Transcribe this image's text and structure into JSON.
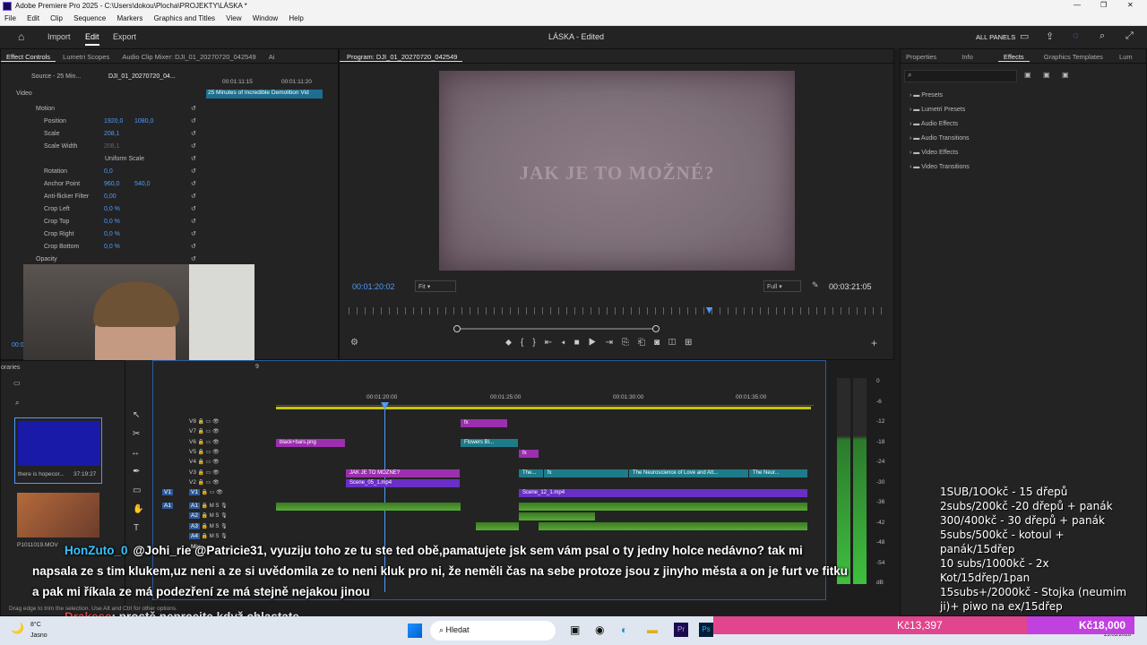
{
  "window": {
    "title": "Adobe Premiere Pro 2025 - C:\\Users\\dokou\\Plocha\\PROJEKTY\\LÁSKA *"
  },
  "menu": [
    "File",
    "Edit",
    "Clip",
    "Sequence",
    "Markers",
    "Graphics and Titles",
    "View",
    "Window",
    "Help"
  ],
  "workspace": {
    "tabs": [
      "Import",
      "Edit",
      "Export"
    ],
    "project_title": "LÁSKA",
    "project_status": "- Edited",
    "all_panels": "ALL PANELS"
  },
  "effect_controls": {
    "tabs": [
      "Effect Controls",
      "Lumetri Scopes",
      "Audio Clip Mixer: DJI_01_20270720_042549",
      "Ai"
    ],
    "source": "Source - 25 Min...",
    "clip": "DJI_01_20270720_04...",
    "ruler": [
      "00:01:11:15",
      "00:01:11:20"
    ],
    "clip_bar": "25 Minutes of Incredible Demolition Vid",
    "section_video": "Video",
    "rows": [
      {
        "label": "Motion",
        "v1": "",
        "v2": ""
      },
      {
        "label": "Position",
        "v1": "1920,0",
        "v2": "1080,0"
      },
      {
        "label": "Scale",
        "v1": "208,1",
        "v2": ""
      },
      {
        "label": "Scale Width",
        "v1": "208,1",
        "v2": ""
      },
      {
        "label": "Uniform Scale",
        "v1": "",
        "v2": ""
      },
      {
        "label": "Rotation",
        "v1": "0,0",
        "v2": ""
      },
      {
        "label": "Anchor Point",
        "v1": "960,0",
        "v2": "540,0"
      },
      {
        "label": "Anti-flicker Filter",
        "v1": "0,00",
        "v2": ""
      },
      {
        "label": "Crop Left",
        "v1": "0,0 %",
        "v2": ""
      },
      {
        "label": "Crop Top",
        "v1": "0,0 %",
        "v2": ""
      },
      {
        "label": "Crop Right",
        "v1": "0,0 %",
        "v2": ""
      },
      {
        "label": "Crop Bottom",
        "v1": "0,0 %",
        "v2": ""
      },
      {
        "label": "Opacity",
        "v1": "",
        "v2": ""
      }
    ],
    "timecode": "00:0"
  },
  "program": {
    "tab": "Program: DJI_01_20270720_042549",
    "overlay_text": "JAK JE TO MOŽNÉ?",
    "timecode": "00:01:20:02",
    "fit": "Fit",
    "quality": "Full",
    "duration": "00:03:21:05"
  },
  "right_panel": {
    "tabs": [
      "Properties",
      "Info",
      "Effects",
      "Graphics Templates",
      "Lum"
    ],
    "items": [
      "Presets",
      "Lumetri Presets",
      "Audio Effects",
      "Audio Transitions",
      "Video Effects",
      "Video Transitions"
    ]
  },
  "project": {
    "label": "oraries",
    "thumb_title": "there is hopecor...",
    "thumb_duration": "37:19:27",
    "thumb2_title": "P1011019.MOV"
  },
  "timeline": {
    "seq_tc": "9",
    "ruler": [
      "00:01:20:00",
      "00:01:25:00",
      "00:01:30:00",
      "00:01:35:00"
    ],
    "video_tracks": [
      "V8",
      "V7",
      "V6",
      "V5",
      "V4",
      "V3",
      "V2",
      "V1"
    ],
    "audio_tracks": [
      "A1",
      "A2",
      "A3",
      "A4",
      "Mix"
    ],
    "clips": {
      "black_bars": "black+bars.png",
      "flowers": "Flowers Bl...",
      "jak": "JAK JE TO MOŽNÉ?",
      "scene05": "Scene_05_1.mp4",
      "scene12": "Scene_12_1.mp4",
      "the1": "The...",
      "neuro": "The Neuroscience of Love and Att...",
      "neur2": "The Neur...",
      "fx": "fx"
    }
  },
  "meter": {
    "scale": [
      "0",
      "-6",
      "-12",
      "-18",
      "-24",
      "-30",
      "-36",
      "-42",
      "-48",
      "-54",
      "dB"
    ]
  },
  "stream": {
    "chat1_user": "HonZuto_0",
    "chat1_text": "@Johi_rie @Patricie31, vyuziju toho ze tu ste ted obě,pamatujete jsk sem vám psal o ty jedny holce nedávno? tak mi",
    "chat1_line2": "napsala ze s tim klukem,uz neni a ze si uvědomila ze to neni kluk pro ni, že neměli čas na sebe protoze jsou z jinyho města a on je furt ve fitku",
    "chat1_line3": "a pak mi říkala ze má podezření ze má stejně nejakou jinou",
    "chat2_user": "Drakesc",
    "chat2_text": ": prostě neprcejte když chlastate",
    "sub_list": [
      "1SUB/1OOkč - 15 dřepů",
      "2subs/200kč -20 dřepů + panák",
      "300/400kč - 30 dřepů + panák",
      "5subs/500kč - kotoul +",
      "panák/15dřep",
      "10 subs/1000kč - 2x",
      "Kot/15dřep/1pan",
      "15subs+/2000kč - Stojka (neumim",
      "ji)+ piwo na ex/15dřep"
    ],
    "goal_current": "Kč13,397",
    "goal_target": "Kč18,000",
    "status_hint": "Drag edge to trim the selection. Use Alt and Ctrl for other options."
  },
  "taskbar": {
    "weather_temp": "8°C",
    "weather_desc": "Jasno",
    "search": "Hledat",
    "date": "23.03.2026"
  },
  "colors": {
    "accent": "#4d9bff",
    "pink_clip": "#9b2fae",
    "teal_clip": "#1e7b8a",
    "purple_clip": "#6a2fc6",
    "audio_green": "#4a8f2a",
    "goal_bar": "#e0458e",
    "goal_bar2": "#c040e0"
  }
}
